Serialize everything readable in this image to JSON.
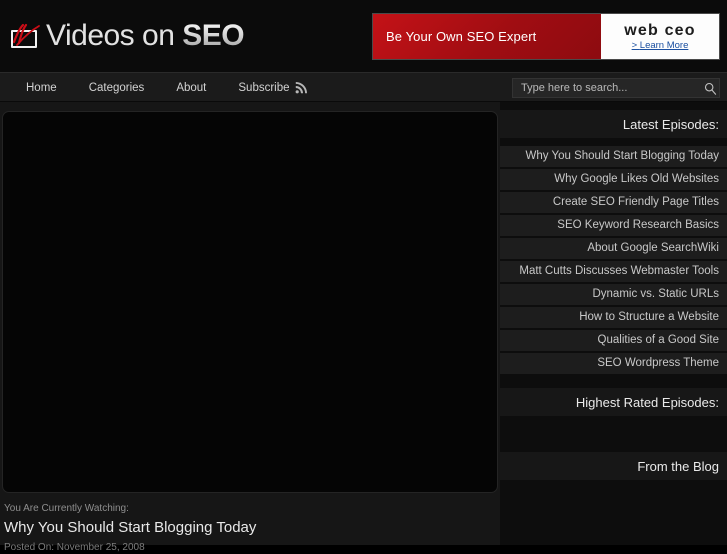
{
  "site": {
    "logo_text_light": "Videos on ",
    "logo_text_bold": "SEO",
    "logo_icon": "video-screen-icon"
  },
  "banner": {
    "headline": "Be Your Own SEO Expert",
    "brand": "web ceo",
    "cta_arrow": "> ",
    "cta": "Learn More",
    "red": "#b5121b",
    "white": "#fdfdfd",
    "link_color": "#1a4fa0"
  },
  "nav": {
    "items": [
      {
        "label": "Home",
        "icon": null
      },
      {
        "label": "Categories",
        "icon": null
      },
      {
        "label": "About",
        "icon": null
      },
      {
        "label": "Subscribe",
        "icon": "rss-icon"
      }
    ]
  },
  "search": {
    "placeholder": "Type here to search...",
    "value": "",
    "icon": "magnifier-icon"
  },
  "player": {
    "state": "blank"
  },
  "now_playing": {
    "label": "You Are Currently Watching:",
    "title": "Why You Should Start Blogging Today",
    "date": "Posted On: November 25, 2008"
  },
  "sidebar": {
    "latest_heading": "Latest Episodes:",
    "latest_episodes": [
      "Why You Should Start Blogging Today",
      "Why Google Likes Old Websites",
      "Create SEO Friendly Page Titles",
      "SEO Keyword Research Basics",
      "About Google SearchWiki",
      "Matt Cutts Discusses Webmaster Tools",
      "Dynamic vs. Static URLs",
      "How to Structure a Website",
      "Qualities of a Good Site",
      "SEO Wordpress Theme"
    ],
    "highest_heading": "Highest Rated Episodes:",
    "highest_episodes": [],
    "blog_heading": "From the Blog",
    "blog_items": []
  },
  "colors": {
    "page_bg": "#0d0d0d",
    "header_bg": "#0b0b0b",
    "nav_bg": "#1b1b1b",
    "accent_red": "#b5121b",
    "text": "#cfcfcf"
  }
}
